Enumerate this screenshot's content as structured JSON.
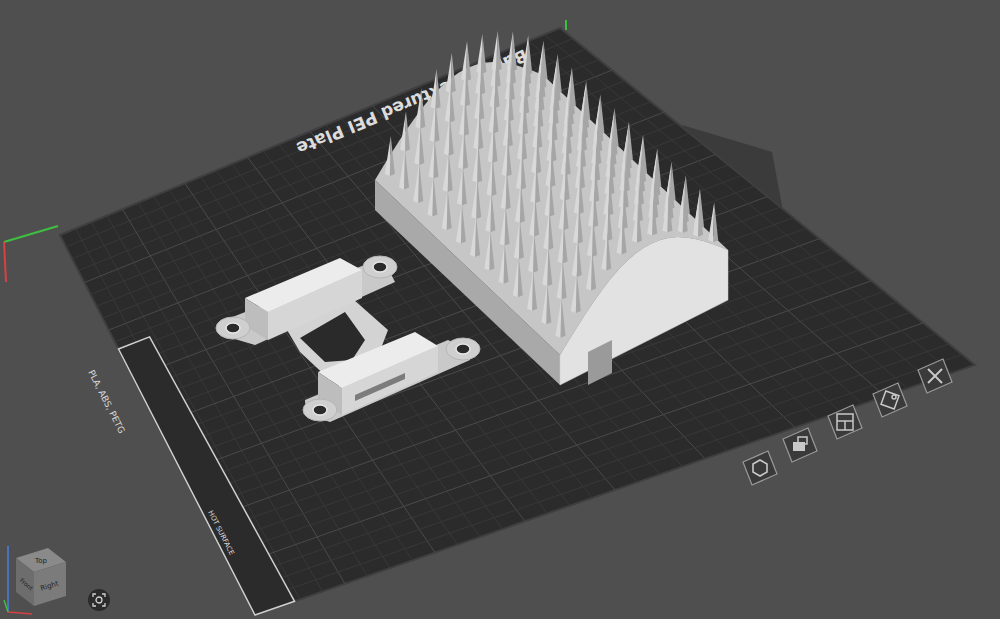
{
  "plate": {
    "name": "Bambu Textured PEI Plate",
    "sticker": {
      "filaments": "PLA, ABS, PETG",
      "warning": "HOT SURFACE"
    }
  },
  "plate_tools": [
    {
      "kind": "orient"
    },
    {
      "kind": "lock"
    },
    {
      "kind": "arrange"
    },
    {
      "kind": "settings"
    },
    {
      "kind": "delete"
    }
  ],
  "view_cube": {
    "faces": [
      "Top",
      "Front",
      "Right"
    ]
  }
}
